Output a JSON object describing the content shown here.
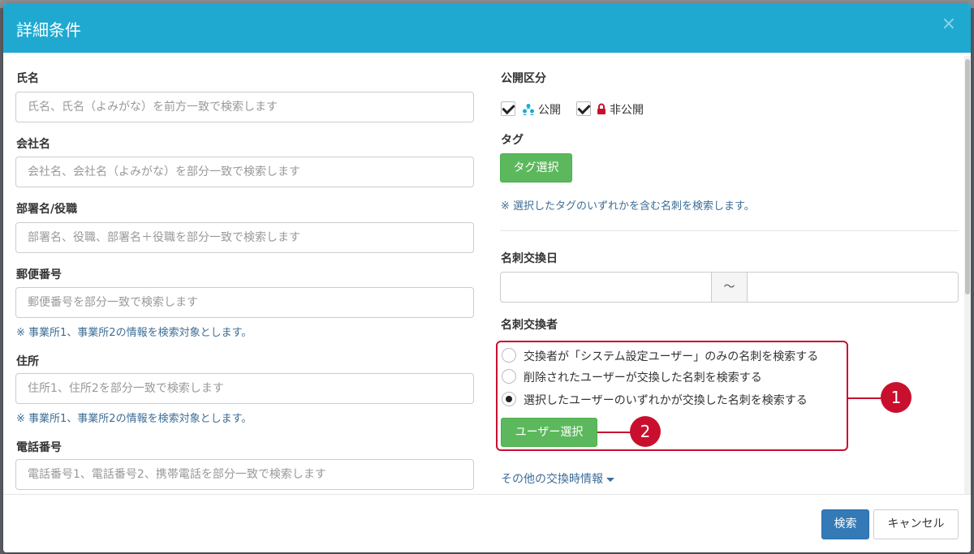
{
  "modal": {
    "title": "詳細条件",
    "close": "×"
  },
  "left": {
    "name": {
      "label": "氏名",
      "placeholder": "氏名、氏名（よみがな）を前方一致で検索します"
    },
    "company": {
      "label": "会社名",
      "placeholder": "会社名、会社名（よみがな）を部分一致で検索します"
    },
    "dept": {
      "label": "部署名/役職",
      "placeholder": "部署名、役職、部署名＋役職を部分一致で検索します"
    },
    "postal": {
      "label": "郵便番号",
      "placeholder": "郵便番号を部分一致で検索します",
      "note": "※ 事業所1、事業所2の情報を検索対象とします。"
    },
    "address": {
      "label": "住所",
      "placeholder": "住所1、住所2を部分一致で検索します",
      "note": "※ 事業所1、事業所2の情報を検索対象とします。"
    },
    "phone": {
      "label": "電話番号",
      "placeholder": "電話番号1、電話番号2、携帯電話を部分一致で検索します"
    }
  },
  "right": {
    "visibility": {
      "label": "公開区分",
      "public": "公開",
      "private": "非公開"
    },
    "tag": {
      "label": "タグ",
      "button": "タグ選択",
      "note": "※ 選択したタグのいずれかを含む名刺を検索します。"
    },
    "exchange_date": {
      "label": "名刺交換日",
      "separator": "～"
    },
    "exchanger": {
      "label": "名刺交換者",
      "options": [
        "交換者が「システム設定ユーザー」のみの名刺を検索する",
        "削除されたユーザーが交換した名刺を検索する",
        "選択したユーザーのいずれかが交換した名刺を検索する"
      ],
      "selected_index": 2,
      "user_button": "ユーザー選択"
    },
    "more_link": "その他の交換時情報"
  },
  "callouts": [
    "1",
    "2"
  ],
  "footer": {
    "search": "検索",
    "cancel": "キャンセル"
  },
  "colors": {
    "header": "#20a9d0",
    "green": "#5cb85c",
    "primary": "#337ab7",
    "callout": "#c8102e",
    "note": "#3d6d96"
  }
}
